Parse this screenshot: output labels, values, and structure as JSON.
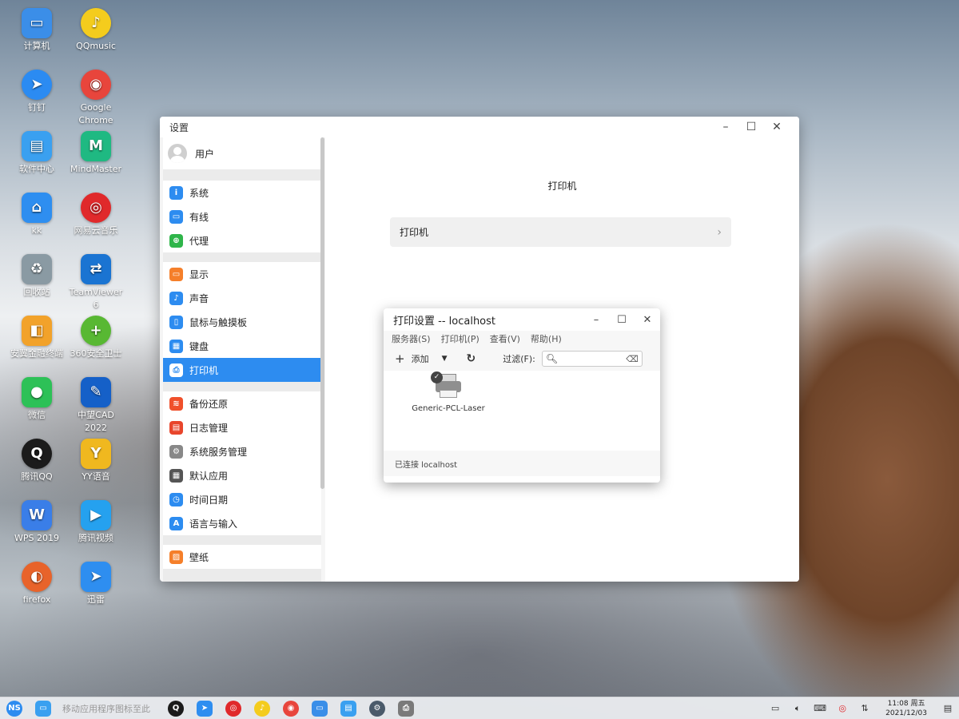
{
  "desktop_icons": [
    {
      "label": "计算机",
      "icon": "computer-icon",
      "color": "#3b8ee8"
    },
    {
      "label": "QQmusic",
      "icon": "music-icon",
      "color": "#f4cc1d"
    },
    {
      "label": "钉钉",
      "icon": "dingtalk-icon",
      "color": "#2b8bf2"
    },
    {
      "label": "Google Chrome",
      "icon": "chrome-icon",
      "color": "#e8453c"
    },
    {
      "label": "软件中心",
      "icon": "store-icon",
      "color": "#3aa0f0"
    },
    {
      "label": "MindMaster",
      "icon": "mindmaster-icon",
      "color": "#1fb982"
    },
    {
      "label": "kk",
      "icon": "home-icon",
      "color": "#2e8ef0"
    },
    {
      "label": "网易云音乐",
      "icon": "netease-music-icon",
      "color": "#e0292b"
    },
    {
      "label": "回收站",
      "icon": "trash-icon",
      "color": "#8a9aa3"
    },
    {
      "label": "TeamViewer 6",
      "icon": "teamviewer-icon",
      "color": "#1a74d2"
    },
    {
      "label": "安翼金融终端",
      "icon": "finance-icon",
      "color": "#f2a22a"
    },
    {
      "label": "360安全卫士",
      "icon": "security360-icon",
      "color": "#58b833"
    },
    {
      "label": "微信",
      "icon": "wechat-icon",
      "color": "#2dc157"
    },
    {
      "label": "中望CAD 2022",
      "icon": "cad-icon",
      "color": "#1560c8"
    },
    {
      "label": "腾讯QQ",
      "icon": "qq-icon",
      "color": "#1b1b1b"
    },
    {
      "label": "YY语音",
      "icon": "yy-icon",
      "color": "#f0b81f"
    },
    {
      "label": "WPS 2019",
      "icon": "wps-icon",
      "color": "#3a7ee8"
    },
    {
      "label": "腾讯视频",
      "icon": "video-icon",
      "color": "#25a1ef"
    },
    {
      "label": "firefox",
      "icon": "firefox-icon",
      "color": "#e8632a"
    },
    {
      "label": "迅雷",
      "icon": "thunder-icon",
      "color": "#2e8ef0"
    }
  ],
  "settings": {
    "title": "设置",
    "user_label": "用户",
    "groups": [
      [
        {
          "label": "系统",
          "icon": "info-icon",
          "color": "#2d8cf0",
          "glyph": "i"
        },
        {
          "label": "有线",
          "icon": "wired-icon",
          "color": "#2d8cf0",
          "glyph": "▭"
        },
        {
          "label": "代理",
          "icon": "globe-icon",
          "color": "#2fb54a",
          "glyph": "⊕"
        }
      ],
      [
        {
          "label": "显示",
          "icon": "display-icon",
          "color": "#f57f2a",
          "glyph": "▭"
        },
        {
          "label": "声音",
          "icon": "sound-icon",
          "color": "#2d8cf0",
          "glyph": "♪"
        },
        {
          "label": "鼠标与触摸板",
          "icon": "mouse-icon",
          "color": "#2d8cf0",
          "glyph": "▯"
        },
        {
          "label": "键盘",
          "icon": "keyboard-icon",
          "color": "#2d8cf0",
          "glyph": "▦"
        },
        {
          "label": "打印机",
          "icon": "printer-icon",
          "color": "#ffffff",
          "glyph": "⎙",
          "active": true
        }
      ],
      [
        {
          "label": "备份还原",
          "icon": "backup-icon",
          "color": "#f0502b",
          "glyph": "≋"
        },
        {
          "label": "日志管理",
          "icon": "log-icon",
          "color": "#e8452c",
          "glyph": "▤"
        },
        {
          "label": "系统服务管理",
          "icon": "service-icon",
          "color": "#888888",
          "glyph": "⚙"
        },
        {
          "label": "默认应用",
          "icon": "default-app-icon",
          "color": "#555555",
          "glyph": "▦"
        },
        {
          "label": "时间日期",
          "icon": "clock-icon",
          "color": "#2d8cf0",
          "glyph": "◷"
        },
        {
          "label": "语言与输入",
          "icon": "language-icon",
          "color": "#2d8cf0",
          "glyph": "A"
        }
      ],
      [
        {
          "label": "壁纸",
          "icon": "wallpaper-icon",
          "color": "#f57f2a",
          "glyph": "▨"
        }
      ]
    ],
    "main_heading": "打印机",
    "main_row_label": "打印机"
  },
  "printer_dialog": {
    "title": "打印设置 -- localhost",
    "menus": [
      "服务器(S)",
      "打印机(P)",
      "查看(V)",
      "帮助(H)"
    ],
    "add_label": "添加",
    "filter_label": "过滤(F):",
    "search_value": "",
    "printers": [
      {
        "name": "Generic-PCL-Laser"
      }
    ],
    "status": "已连接 localhost"
  },
  "taskbar": {
    "hint": "移动应用程序图标至此",
    "time": "11:08",
    "weekday": "周五",
    "date": "2021/12/03",
    "colors": {
      "launcher": "#2d8cf0"
    }
  }
}
